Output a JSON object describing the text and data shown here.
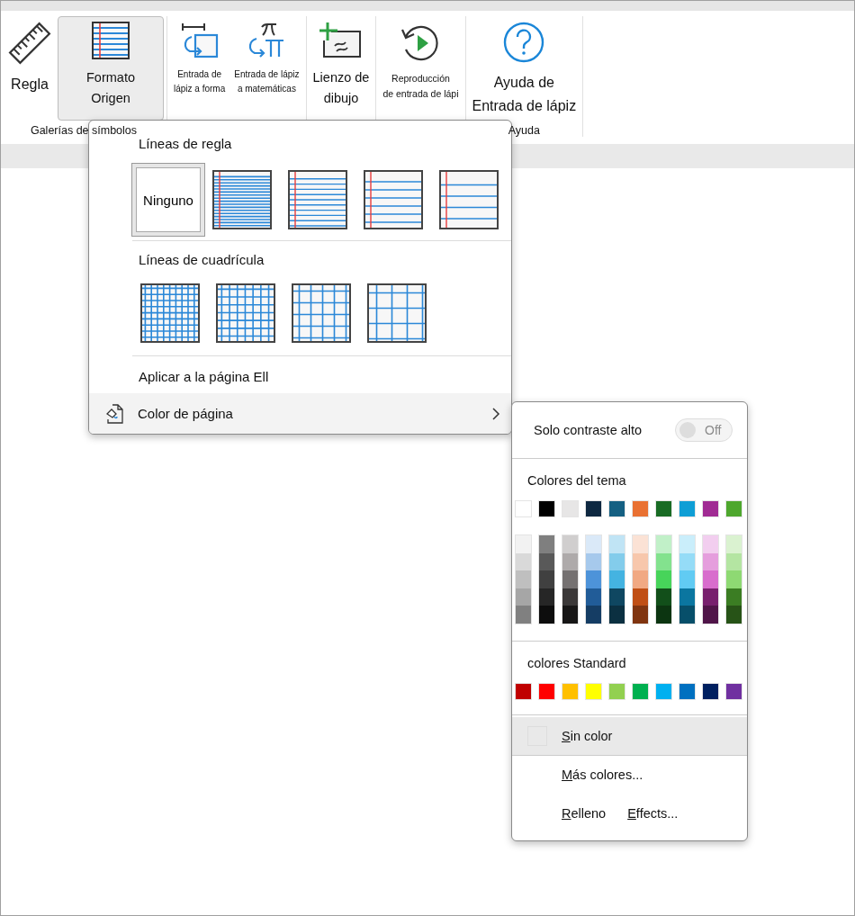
{
  "ribbon": {
    "groups": [
      {
        "label": "Galerías de símbolos",
        "buttons": [
          {
            "kind": "ruler",
            "lines": [
              "Regla"
            ],
            "selected": false
          },
          {
            "kind": "format",
            "lines": [
              "Formato",
              "Origen"
            ],
            "selected": true
          }
        ]
      },
      {
        "buttons": [
          {
            "kind": "ink-shape",
            "lines": [
              "Entrada de",
              "lápiz a forma"
            ],
            "selected": false
          },
          {
            "kind": "ink-math",
            "lines": [
              "Entrada de lápiz",
              "a matemáticas"
            ],
            "selected": false
          }
        ]
      },
      {
        "buttons": [
          {
            "kind": "canvas",
            "lines": [
              "Lienzo de",
              "dibujo"
            ],
            "selected": false
          }
        ]
      },
      {
        "buttons": [
          {
            "kind": "replay",
            "lines": [
              "Reproducción",
              "de entrada de lápi"
            ],
            "selected": false
          }
        ]
      },
      {
        "label": "Ayuda",
        "buttons": [
          {
            "kind": "help",
            "lines": [
              "Ayuda de",
              "Entrada de lápiz"
            ],
            "selected": false
          }
        ]
      }
    ]
  },
  "format_menu": {
    "ruled_title": "Líneas de regla",
    "ruled": [
      {
        "kind": "none",
        "label": "Ninguno",
        "selected": true
      },
      {
        "kind": "narrow",
        "selected": false
      },
      {
        "kind": "college",
        "selected": false
      },
      {
        "kind": "standard",
        "selected": false
      },
      {
        "kind": "wide",
        "selected": false
      }
    ],
    "grid_title": "Líneas de cuadrícula",
    "grid": [
      {
        "kind": "small",
        "selected": false
      },
      {
        "kind": "medium",
        "selected": false
      },
      {
        "kind": "large",
        "selected": false
      },
      {
        "kind": "xlarge",
        "selected": false
      }
    ],
    "apply_all": "Aplicar a la página Ell",
    "page_color": {
      "label": "Color de página",
      "expanded": true
    }
  },
  "page_color_menu": {
    "toggle": {
      "label": "Solo contraste alto",
      "state_text": "Off",
      "on": false
    },
    "theme_title": "Colores del tema",
    "theme_top": [
      {
        "color": "#ffffff"
      },
      {
        "color": "#000000"
      },
      {
        "color": "#e7e6e6"
      },
      {
        "color": "#0e2841"
      },
      {
        "color": "#156082"
      },
      {
        "color": "#e97132"
      },
      {
        "color": "#196b24"
      },
      {
        "color": "#0f9ed5"
      },
      {
        "color": "#a02b93"
      },
      {
        "color": "#4ea72e"
      }
    ],
    "theme_shades": [
      {
        "colors": [
          {
            "color": "#f2f2f2"
          },
          {
            "color": "#d9d9d9"
          },
          {
            "color": "#bfbfbf"
          },
          {
            "color": "#a6a6a6"
          },
          {
            "color": "#808080"
          }
        ]
      },
      {
        "colors": [
          {
            "color": "#7f7f7f"
          },
          {
            "color": "#595959"
          },
          {
            "color": "#404040"
          },
          {
            "color": "#262626"
          },
          {
            "color": "#0d0d0d"
          }
        ]
      },
      {
        "colors": [
          {
            "color": "#d0cece"
          },
          {
            "color": "#aeaaaa"
          },
          {
            "color": "#757171"
          },
          {
            "color": "#3b3838"
          },
          {
            "color": "#171616"
          }
        ]
      },
      {
        "colors": [
          {
            "color": "#dae9f8"
          },
          {
            "color": "#a6c9ec"
          },
          {
            "color": "#4d93d9"
          },
          {
            "color": "#215c98"
          },
          {
            "color": "#153d64"
          }
        ]
      },
      {
        "colors": [
          {
            "color": "#c0e4f5"
          },
          {
            "color": "#83cceb"
          },
          {
            "color": "#44b3e1"
          },
          {
            "color": "#0f4761"
          },
          {
            "color": "#0b3041"
          }
        ]
      },
      {
        "colors": [
          {
            "color": "#fbe2d5"
          },
          {
            "color": "#f7c7ac"
          },
          {
            "color": "#f1a983"
          },
          {
            "color": "#c04f15"
          },
          {
            "color": "#803510"
          }
        ]
      },
      {
        "colors": [
          {
            "color": "#c1f0c8"
          },
          {
            "color": "#83e28e"
          },
          {
            "color": "#47d45a"
          },
          {
            "color": "#124f1a"
          },
          {
            "color": "#0c3511"
          }
        ]
      },
      {
        "colors": [
          {
            "color": "#caeefb"
          },
          {
            "color": "#95dcf7"
          },
          {
            "color": "#61cbf3"
          },
          {
            "color": "#0b76a0"
          },
          {
            "color": "#074f6a"
          }
        ]
      },
      {
        "colors": [
          {
            "color": "#f2ceef"
          },
          {
            "color": "#e59edd"
          },
          {
            "color": "#d86dcd"
          },
          {
            "color": "#78206e"
          },
          {
            "color": "#501549"
          }
        ]
      },
      {
        "colors": [
          {
            "color": "#daf2d0"
          },
          {
            "color": "#b4e5a2"
          },
          {
            "color": "#8ed973"
          },
          {
            "color": "#3b7d23"
          },
          {
            "color": "#275317"
          }
        ]
      }
    ],
    "standard_title": "colores Standard",
    "standard": [
      {
        "color": "#c00000"
      },
      {
        "color": "#ff0000"
      },
      {
        "color": "#ffc000"
      },
      {
        "color": "#ffff00"
      },
      {
        "color": "#92d050"
      },
      {
        "color": "#00b050"
      },
      {
        "color": "#00b0f0"
      },
      {
        "color": "#0070c0"
      },
      {
        "color": "#002060"
      },
      {
        "color": "#7030a0"
      }
    ],
    "items": [
      {
        "kind": "no-color",
        "label": "Sin color",
        "selected": true
      },
      {
        "kind": "text",
        "label": "Más colores...",
        "selected": false
      },
      {
        "kind": "pair",
        "label": "Relleno",
        "extra": "Effects...",
        "selected": false
      }
    ]
  }
}
